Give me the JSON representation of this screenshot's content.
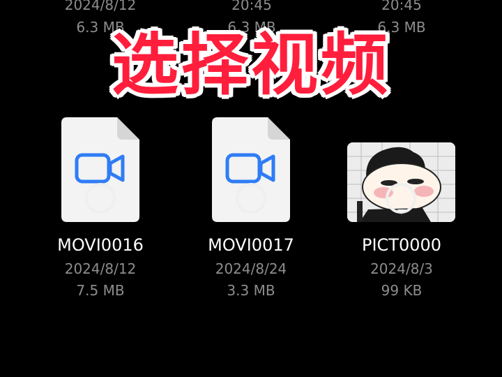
{
  "top_row": [
    {
      "line1": "2024/8/12",
      "line2": "6.3 MB"
    },
    {
      "line1": "20:45",
      "line2": "6.3 MB"
    },
    {
      "line1": "20:45",
      "line2": "6.3 MB"
    }
  ],
  "overlay": {
    "title": "选择视频",
    "color": "#ff1e3c"
  },
  "files": [
    {
      "name": "MOVI0016",
      "date": "2024/8/12",
      "size": "7.5 MB",
      "icon": "video-camera-icon"
    },
    {
      "name": "MOVI0017",
      "date": "2024/8/24",
      "size": "3.3 MB",
      "icon": "video-camera-icon"
    },
    {
      "name": "PICT0000",
      "date": "2024/8/3",
      "size": "99 KB",
      "icon": "image-thumbnail"
    }
  ],
  "colors": {
    "accent": "#2f7cf6",
    "background": "#000000",
    "secondary_text": "#8d8d8d"
  }
}
